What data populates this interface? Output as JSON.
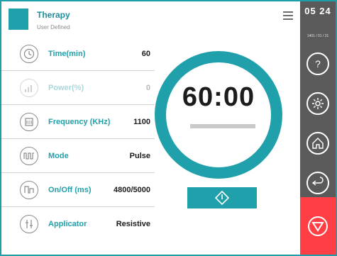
{
  "header": {
    "title": "Therapy",
    "subtitle": "User Defined",
    "accent_color": "#1fa0aa"
  },
  "status": {
    "time": "05 24",
    "date": "1401 / 01 / 31"
  },
  "params": [
    {
      "icon": "clock-icon",
      "label": "Time(min)",
      "value": "60",
      "enabled": true
    },
    {
      "icon": "signal-bars-icon",
      "label": "Power(%)",
      "value": "0",
      "enabled": false
    },
    {
      "icon": "frequency-icon",
      "label": "Frequency (KHz)",
      "value": "1100",
      "enabled": true
    },
    {
      "icon": "pulse-wave-icon",
      "label": "Mode",
      "value": "Pulse",
      "enabled": true
    },
    {
      "icon": "on-off-wave-icon",
      "label": "On/Off (ms)",
      "value": "4800/5000",
      "enabled": true
    },
    {
      "icon": "applicator-icon",
      "label": "Applicator",
      "value": "Resistive",
      "enabled": true
    }
  ],
  "timer": {
    "display": "60:00",
    "progress": 0
  },
  "buttons": {
    "start_icon": "start-diamond-icon",
    "stop_icon": "stop-triangle-icon"
  },
  "rail_buttons": [
    {
      "icon": "help-icon"
    },
    {
      "icon": "settings-gear-icon"
    },
    {
      "icon": "home-icon"
    },
    {
      "icon": "back-arrow-icon"
    }
  ],
  "colors": {
    "teal": "#1fa0aa",
    "rail": "#5a5a5a",
    "stop": "#ff3f45"
  }
}
